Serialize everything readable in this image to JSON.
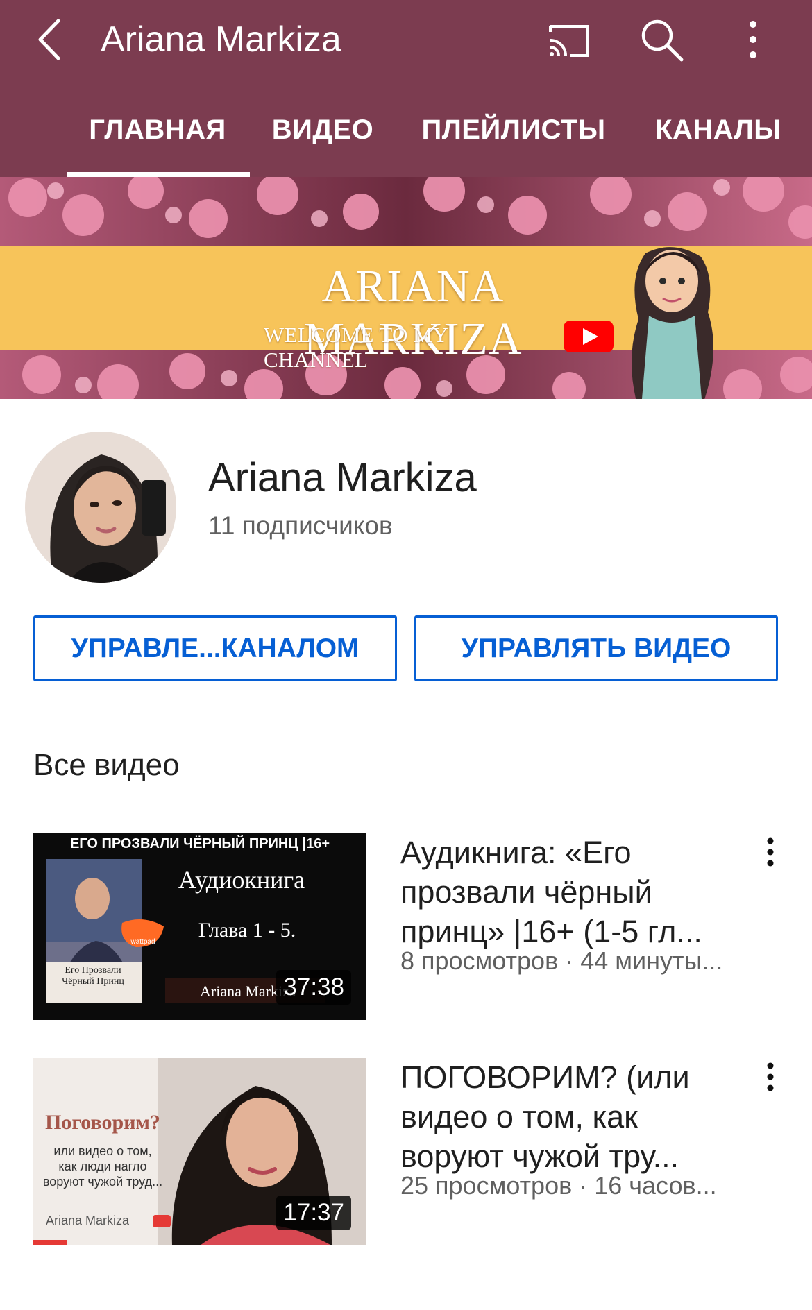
{
  "appbar": {
    "title": "Ariana Markiza"
  },
  "tabs": [
    {
      "label": "ГЛАВНАЯ",
      "active": true
    },
    {
      "label": "ВИДЕО",
      "active": false
    },
    {
      "label": "ПЛЕЙЛИСТЫ",
      "active": false
    },
    {
      "label": "КАНАЛЫ",
      "active": false
    }
  ],
  "banner": {
    "title": "ARIANA MARKIZA",
    "subtitle": "WELCOME TO MY CHANNEL"
  },
  "channel": {
    "name": "Ariana Markiza",
    "subscribers": "11 подписчиков"
  },
  "buttons": {
    "manage_channel": "УПРАВЛЕ...КАНАЛОМ",
    "manage_videos": "УПРАВЛЯТЬ ВИДЕО"
  },
  "section": {
    "title": "Все видео"
  },
  "videos": [
    {
      "title_lines": [
        "Аудикнига: «Его",
        "прозвали чёрный",
        "принц» |16+ (1-5 гл..."
      ],
      "meta": "8 просмотров · 44 минуты...",
      "duration": "37:38",
      "thumb": {
        "header": "ЕГО ПРОЗВАЛИ ЧЁРНЫЙ ПРИНЦ |16+",
        "line1": "Аудиокнига",
        "line2": "Глава 1 - 5.",
        "author": "Ariana Markiza",
        "book1": "Его Прозвали",
        "book2": "Чёрный Принц",
        "badge": "wattpad"
      }
    },
    {
      "title_lines": [
        "ПОГОВОРИМ? (или",
        "видео о том, как",
        "воруют чужой тру..."
      ],
      "meta": "25 просмотров · 16 часов...",
      "duration": "17:37",
      "thumb": {
        "headline": "Поговорим?",
        "l1": "или видео о том,",
        "l2": "как люди нагло",
        "l3": "воруют чужой труд...",
        "author": "Ariana Markiza"
      }
    }
  ],
  "colors": {
    "appbar": "#7c3c50",
    "accent": "#065fd4",
    "banner_band": "#f7c45a"
  }
}
